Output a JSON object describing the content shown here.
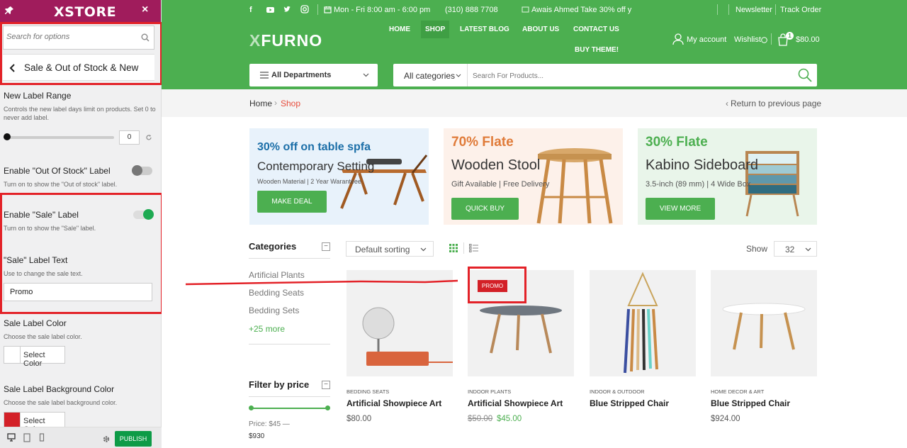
{
  "panel": {
    "logo": "XSTORE",
    "close": "×",
    "search_placeholder": "Search for options",
    "section_title": "Sale & Out of Stock & New",
    "new_label_range": {
      "title": "New Label Range",
      "desc": "Controls the new label days limit on products. Set 0 to never add label.",
      "value": "0"
    },
    "out_of_stock": {
      "title": "Enable \"Out Of Stock\" Label",
      "desc": "Turn on to show the \"Out of stock\" label.",
      "enabled": false
    },
    "sale": {
      "title": "Enable \"Sale\" Label",
      "desc": "Turn on to show the \"Sale\" label.",
      "enabled": true
    },
    "sale_text": {
      "title": "\"Sale\" Label Text",
      "desc": "Use to change the sale text.",
      "value": "Promo"
    },
    "sale_color": {
      "title": "Sale Label Color",
      "desc": "Choose the sale label color.",
      "button": "Select Color",
      "swatch": "#ffffff"
    },
    "sale_bg": {
      "title": "Sale Label Background Color",
      "desc": "Choose the sale label background color.",
      "button": "Select Color",
      "swatch": "#d32027"
    },
    "publish": "PUBLISH"
  },
  "site": {
    "topbar": {
      "hours": "Mon - Fri 8:00 am - 6:00 pm",
      "phone": "(310) 888 7708",
      "promo": "Awais Ahmed Take 30% off y",
      "newsletter": "Newsletter",
      "track": "Track Order"
    },
    "brand": {
      "x": "X",
      "rest": "FURNO"
    },
    "nav": {
      "home": "HOME",
      "shop": "SHOP",
      "blog": "LATEST BLOG",
      "about": "ABOUT US",
      "contact": "CONTACT US",
      "buy": "BUY THEME!"
    },
    "account": {
      "my_account": "My account",
      "wishlist": "Wishlist",
      "cart_count": "1",
      "cart_total": "$80.00"
    },
    "departments": "All Departments",
    "search": {
      "category": "All categories",
      "placeholder": "Search For Products..."
    },
    "breadcrumb": {
      "home": "Home",
      "current": "Shop",
      "return": "Return to previous page"
    },
    "banners": [
      {
        "heading": "30% off on table spfa",
        "subtitle": "Contemporary Setting",
        "small": "Wooden Material   |   2 Year Waranteee",
        "button": "MAKE DEAL"
      },
      {
        "heading": "70% Flate",
        "subtitle": "Wooden Stool",
        "small": "Gift Available   |   Free Delivery",
        "button": "QUICK BUY"
      },
      {
        "heading": "30% Flate",
        "subtitle": "Kabino Sideboard",
        "small": "3.5-inch (89 mm)   |   4 Wide Box",
        "button": "VIEW MORE"
      }
    ],
    "categories": {
      "title": "Categories",
      "items": [
        "Artificial Plants",
        "Bedding Seats",
        "Bedding Sets"
      ],
      "more": "+25 more"
    },
    "filter": {
      "title": "Filter by price",
      "price_label": "Price: $45 —",
      "price_max": "$930"
    },
    "toolbar": {
      "sorting": "Default sorting",
      "show_label": "Show",
      "show_value": "32"
    },
    "products": [
      {
        "category": "BEDDING SEATS",
        "name": "Artificial Showpiece Art",
        "price": "$80.00"
      },
      {
        "category": "INDOOR PLANTS",
        "name": "Artificial Showpiece Art",
        "old_price": "$50.00",
        "price": "$45.00",
        "badge": "PROMO"
      },
      {
        "category": "INDOOR & OUTDOOR",
        "name": "Blue Stripped Chair",
        "price": ""
      },
      {
        "category": "HOME DECOR & ART",
        "name": "Blue Stripped Chair",
        "price": "$924.00"
      }
    ]
  },
  "colors": {
    "brand_green": "#4caf50",
    "customizer_magenta": "#a01c5c",
    "highlight_red": "#e32228",
    "sale_red": "#d32027",
    "shop_red": "#e74c3c",
    "publish_green": "#0d9b47"
  }
}
